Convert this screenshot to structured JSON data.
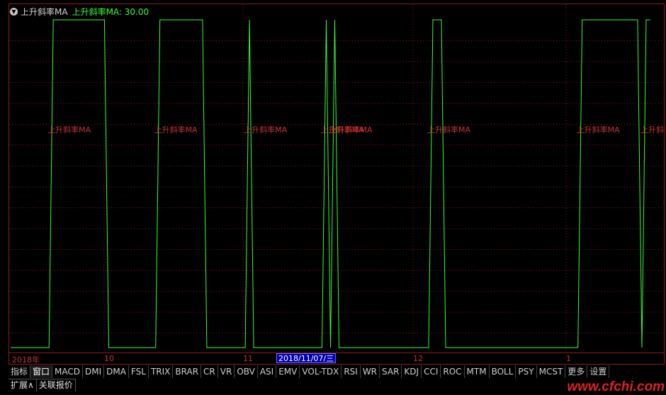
{
  "header": {
    "indicator_name": "上升斜率MA",
    "indicator_value": "上升斜率MA: 30.00"
  },
  "signal_label": "上升斜率MA",
  "date_axis": {
    "labels": [
      "2018年",
      "10",
      "11",
      "12",
      "1"
    ],
    "cursor_date": "2018/11/07/三"
  },
  "tabs": [
    "指标",
    "窗口",
    "MACD",
    "DMI",
    "DMA",
    "FSL",
    "TRIX",
    "BRAR",
    "CR",
    "VR",
    "OBV",
    "ASI",
    "EMV",
    "VOL-TDX",
    "RSI",
    "WR",
    "SAR",
    "KDJ",
    "CCI",
    "ROC",
    "MTM",
    "BOLL",
    "PSY",
    "MCST",
    "更多",
    "设置"
  ],
  "bottom_tabs": [
    "扩展∧",
    "关联报价"
  ],
  "watermark": "www.cfchi.com",
  "colors": {
    "line": "#33ff33",
    "grid": "#8a1c1c",
    "label": "#c83232",
    "axis_text": "#c83232"
  },
  "chart_data": {
    "type": "line",
    "title": "",
    "series": [
      {
        "name": "上升斜率MA",
        "values": [
          0,
          0,
          0,
          0,
          0,
          0,
          0,
          0,
          0,
          0,
          1,
          1,
          1,
          1,
          1,
          1,
          1,
          1,
          1,
          1,
          1,
          1,
          1,
          0,
          0,
          0,
          0,
          0,
          0,
          0,
          0,
          0,
          0,
          0,
          0,
          1,
          1,
          1,
          1,
          1,
          1,
          1,
          1,
          1,
          1,
          1,
          0,
          0,
          0,
          0,
          0,
          0,
          0,
          0,
          0,
          0,
          1,
          0,
          0,
          0,
          0,
          0,
          0,
          0,
          0,
          0,
          0,
          0,
          0,
          0,
          0,
          0,
          0,
          0,
          1,
          0,
          1,
          0,
          0,
          0,
          0,
          0,
          0,
          0,
          0,
          0,
          0,
          0,
          0,
          0,
          0,
          0,
          0,
          0,
          0,
          0,
          0,
          0,
          0,
          1,
          1,
          1,
          0,
          0,
          0,
          0,
          0,
          0,
          0,
          0,
          0,
          0,
          0,
          0,
          0,
          0,
          0,
          0,
          0,
          0,
          0,
          0,
          0,
          0,
          0,
          0,
          0,
          0,
          0,
          0,
          0,
          0,
          0,
          0,
          1,
          1,
          1,
          1,
          1,
          1,
          1,
          1,
          1,
          1,
          1,
          1,
          1,
          1,
          0,
          1,
          1
        ]
      }
    ],
    "ylim": [
      0,
      1
    ],
    "grid": true
  }
}
